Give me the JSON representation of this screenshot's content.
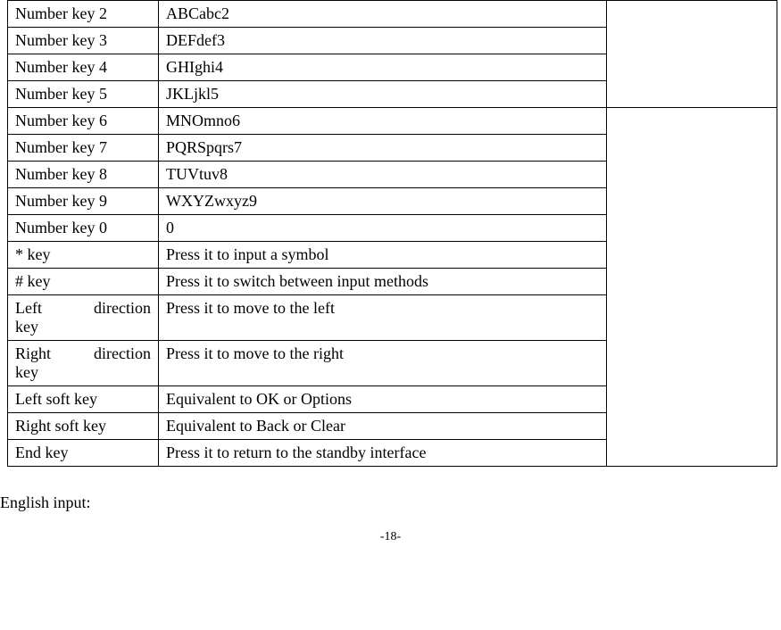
{
  "rows_group1": [
    {
      "key": "Number key 2",
      "value": "ABCabc2"
    },
    {
      "key": "Number key 3",
      "value": "DEFdef3"
    },
    {
      "key": "Number key 4",
      "value": "GHIghi4"
    },
    {
      "key": "Number key 5",
      "value": "JKLjkl5"
    }
  ],
  "rows_group2": [
    {
      "key": "Number key 6",
      "value": "MNOmno6"
    },
    {
      "key": "Number key 7",
      "value": "PQRSpqrs7"
    },
    {
      "key": "Number key 8",
      "value": "TUVtuv8"
    },
    {
      "key": "Number key 9",
      "value": "WXYZwxyz9"
    },
    {
      "key": "Number key 0",
      "value": "0"
    },
    {
      "key": "* key",
      "value": "Press it to input a symbol"
    },
    {
      "key": "# key",
      "value": "Press it to switch between input methods"
    },
    {
      "key": "Left direction key",
      "value": "Press it to move to the left"
    },
    {
      "key": "Right direction key",
      "value": "Press it to move to the right"
    },
    {
      "key": "Left soft key",
      "value": "Equivalent to OK or Options"
    },
    {
      "key": "Right soft key",
      "value": "Equivalent to Back or Clear"
    },
    {
      "key": "End key",
      "value": "Press it to return to the standby interface"
    }
  ],
  "footer": "English input:",
  "page_number": "-18-"
}
